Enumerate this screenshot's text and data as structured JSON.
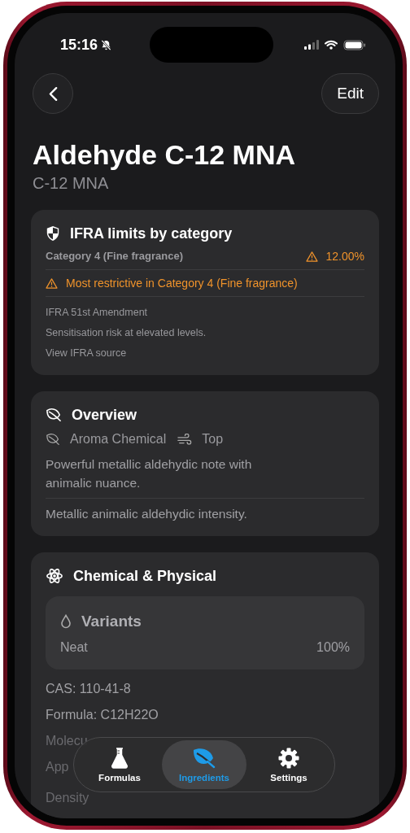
{
  "status_bar": {
    "time": "15:16",
    "silent": true
  },
  "nav": {
    "edit_button": "Edit"
  },
  "title": "Aldehyde C-12 MNA",
  "subtitle": "C-12 MNA",
  "ifra": {
    "title": "IFRA limits by category",
    "category": "Category 4 (Fine fragrance)",
    "limit": "12.00%",
    "warning": "Most restrictive in Category 4 (Fine fragrance)",
    "notes": [
      "IFRA 51st Amendment",
      "Sensitisation risk at elevated levels."
    ],
    "link": "View IFRA source"
  },
  "overview": {
    "title": "Overview",
    "tags": [
      {
        "kind": "type",
        "label": "Aroma Chemical"
      },
      {
        "kind": "note",
        "label": "Top"
      }
    ],
    "description": "Powerful metallic aldehydic note with animalic nuance.",
    "summary": "Metallic animalic aldehydic intensity."
  },
  "chemical": {
    "title": "Chemical & Physical",
    "variants": {
      "title": "Variants",
      "rows": [
        {
          "name": "Neat",
          "percent": "100%"
        }
      ]
    },
    "properties": [
      "CAS: 110-41-8",
      "Formula: C12H22O",
      "Molecu",
      "App",
      "Density"
    ]
  },
  "tab_bar": {
    "tabs": [
      {
        "kind": "formulas",
        "label": "Formulas",
        "selected": false
      },
      {
        "kind": "ingredients",
        "label": "Ingredients",
        "selected": true
      },
      {
        "kind": "settings",
        "label": "Settings",
        "selected": false
      }
    ]
  }
}
